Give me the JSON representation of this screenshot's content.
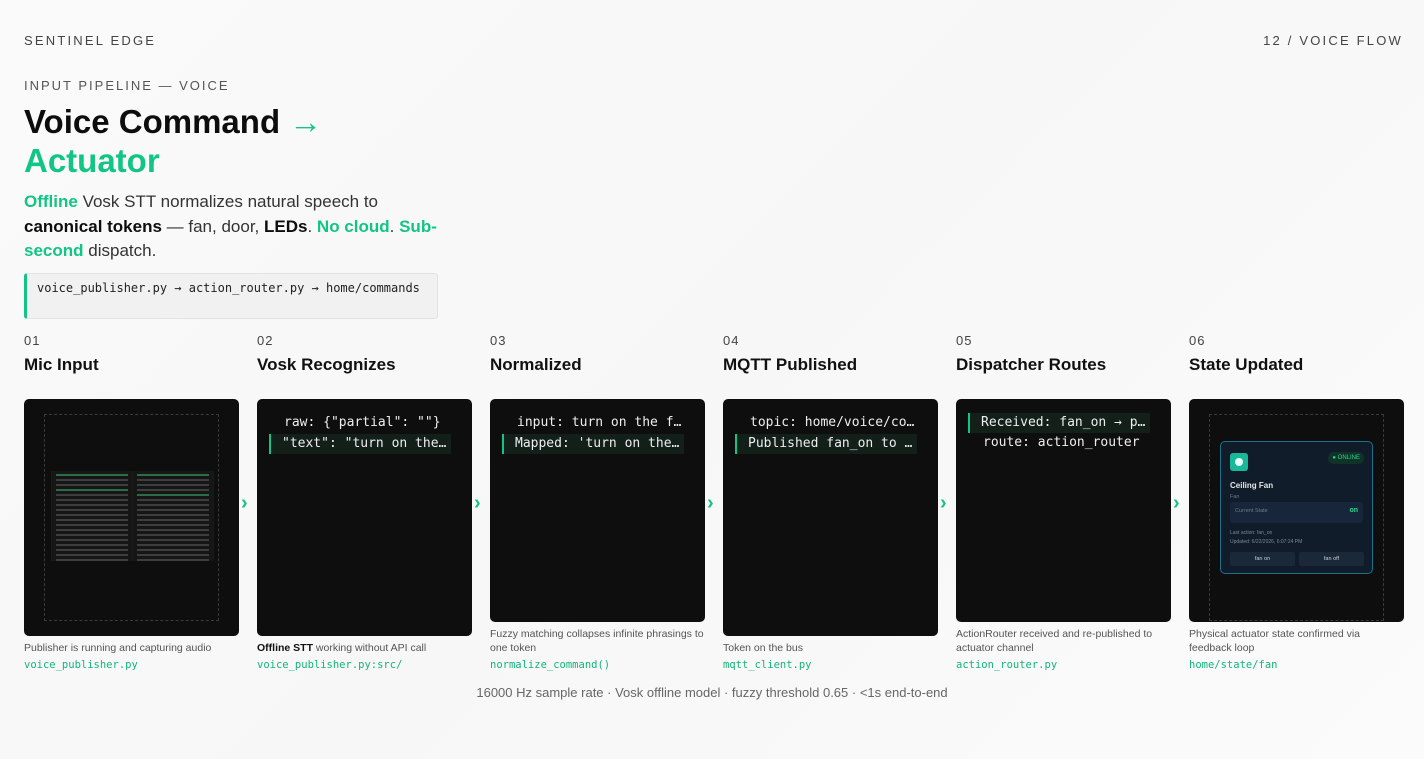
{
  "header": {
    "brand": "SENTINEL EDGE",
    "pager": "12 / VOICE FLOW"
  },
  "hero": {
    "eyebrow": "INPUT PIPELINE — VOICE",
    "title_part1": "Voice Command",
    "title_arrow": "→",
    "title_part2": "Actuator",
    "lede": {
      "offline": "Offline",
      "t1": " Vosk STT normalizes natural speech to ",
      "canonical": "canonical tokens",
      "t2": " — fan, door, ",
      "leds": "LEDs",
      "t3": ". ",
      "nocloud": "No cloud",
      "t4": ". ",
      "subsecond": "Sub-second",
      "t5": " dispatch."
    },
    "path": "voice_publisher.py → action_router.py → home/commands"
  },
  "steps": [
    {
      "num": "01",
      "name": "Mic Input",
      "caption": "Publisher is running and capturing audio",
      "file": "voice_publisher.py"
    },
    {
      "num": "02",
      "name": "Vosk Recognizes",
      "caption_bold": "Offline STT",
      "caption": " working without API call",
      "file": "voice_publisher.py:src/",
      "lines": [
        "raw: {\"partial\": \"\"}",
        "\"text\": \"turn on the fan\""
      ]
    },
    {
      "num": "03",
      "name": "Normalized",
      "caption": "Fuzzy matching collapses infinite phrasings to one token",
      "file": "normalize_command()",
      "lines": [
        "input: turn on the fan",
        "Mapped: 'turn on the fan' → fan_on"
      ]
    },
    {
      "num": "04",
      "name": "MQTT Published",
      "caption": "Token on the bus",
      "file": "mqtt_client.py",
      "lines": [
        "topic: home/voice/commands",
        "Published fan_on to home/voice/commands"
      ]
    },
    {
      "num": "05",
      "name": "Dispatcher Routes",
      "caption": "ActionRouter received and re-published to actuator channel",
      "file": "action_router.py",
      "lines": [
        "Received: fan_on → publishing",
        "route: action_router"
      ]
    },
    {
      "num": "06",
      "name": "State Updated",
      "caption": "Physical actuator state confirmed via feedback loop",
      "file": "home/state/fan"
    }
  ],
  "device": {
    "status": "● ONLINE",
    "title": "Ceiling Fan",
    "subtitle": "Fan",
    "state_label": "Current State",
    "state_value": "on",
    "last_action": "Last action: fan_on",
    "updated": "Updated: 6/22/2026, 6:07:24 PM",
    "btn_on": "fan on",
    "btn_off": "fan off"
  },
  "arrow_glyph": "›",
  "footer": "16000 Hz sample rate · Vosk offline model · fuzzy threshold 0.65 · <1s end-to-end",
  "colors": {
    "accent": "#13c584",
    "card": "#0e0e0e",
    "device_border": "#1c6f8a"
  }
}
